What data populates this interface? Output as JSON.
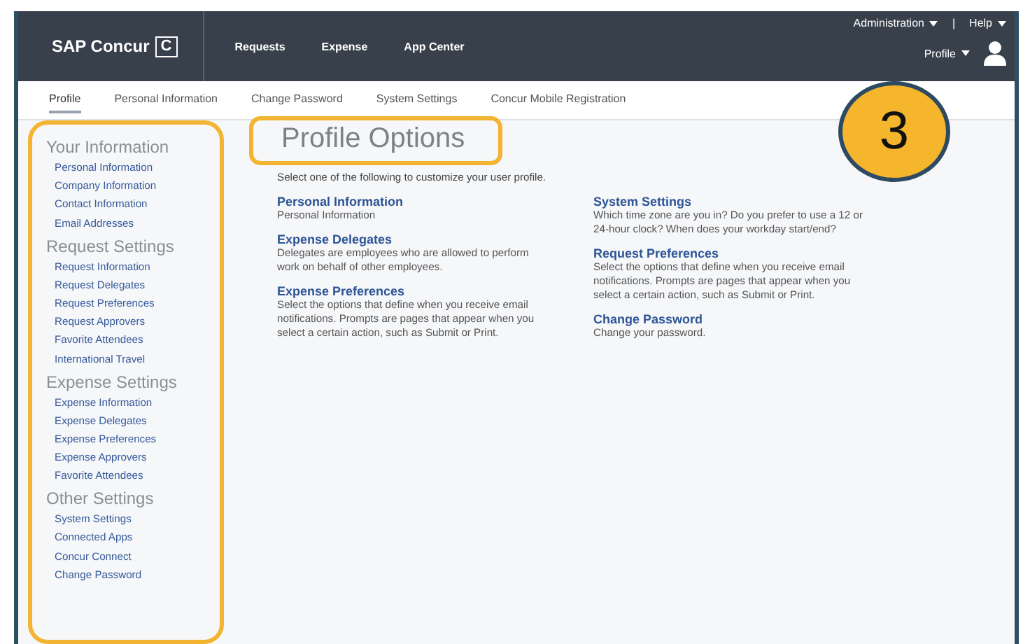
{
  "header": {
    "logo": "SAP Concur",
    "logo_mark": "C",
    "nav": [
      "Requests",
      "Expense",
      "App Center"
    ],
    "admin_menu": "Administration",
    "separator": "|",
    "help_menu": "Help",
    "profile_menu": "Profile"
  },
  "tabs": [
    {
      "label": "Profile",
      "selected": true
    },
    {
      "label": "Personal Information",
      "selected": false
    },
    {
      "label": "Change Password",
      "selected": false
    },
    {
      "label": "System Settings",
      "selected": false
    },
    {
      "label": "Concur Mobile Registration",
      "selected": false
    }
  ],
  "sidebar": {
    "sections": [
      {
        "title": "Your Information",
        "items": [
          "Personal Information",
          "Company Information",
          "Contact Information",
          "Email Addresses"
        ]
      },
      {
        "title": "Request Settings",
        "items": [
          "Request Information",
          "Request Delegates",
          "Request Preferences",
          "Request Approvers",
          "Favorite Attendees",
          "International Travel"
        ]
      },
      {
        "title": "Expense Settings",
        "items": [
          "Expense Information",
          "Expense Delegates",
          "Expense Preferences",
          "Expense Approvers",
          "Favorite Attendees"
        ]
      },
      {
        "title": "Other Settings",
        "items": [
          "System Settings",
          "Connected Apps",
          "Concur Connect",
          "Change Password"
        ]
      }
    ]
  },
  "main": {
    "title": "Profile Options",
    "intro": "Select one of the following to customize your user profile.",
    "columns": [
      [
        {
          "title": "Personal Information",
          "description": "Personal Information"
        },
        {
          "title": "Expense Delegates",
          "description": "Delegates are employees who are allowed to perform work on behalf of other employees."
        },
        {
          "title": "Expense Preferences",
          "description": "Select the options that define when you receive email notifications. Prompts are pages that appear when you select a certain action, such as Submit or Print."
        }
      ],
      [
        {
          "title": "System Settings",
          "description": "Which time zone are you in? Do you prefer to use a 12 or 24-hour clock? When does your workday start/end?"
        },
        {
          "title": "Request Preferences",
          "description": "Select the options that define when you receive email notifications. Prompts are pages that appear when you select a certain action, such as Submit or Print."
        },
        {
          "title": "Change Password",
          "description": "Change your password."
        }
      ]
    ]
  },
  "step_badge": "3"
}
